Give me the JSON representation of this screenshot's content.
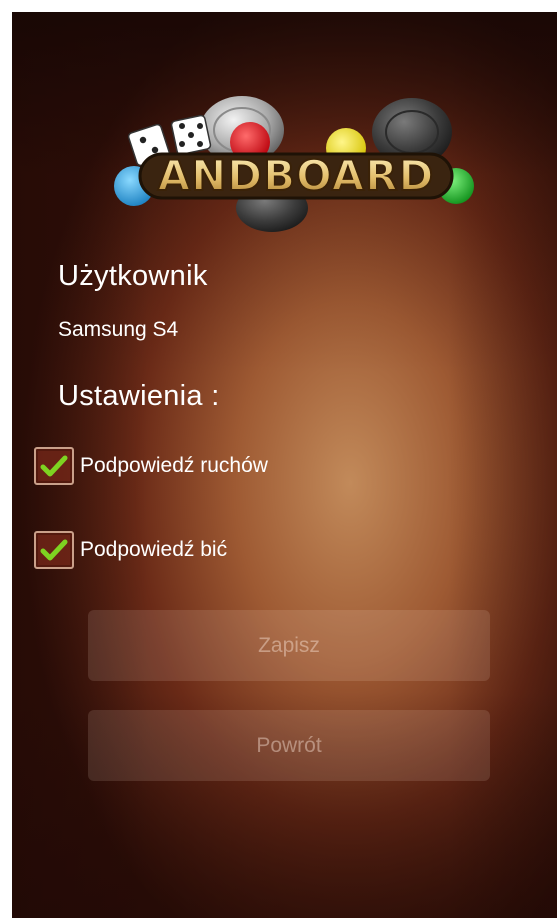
{
  "app": {
    "logo_text": "ANDBOARD"
  },
  "user": {
    "title": "Użytkownik",
    "device_name": "Samsung S4"
  },
  "settings": {
    "title": "Ustawienia :",
    "options": [
      {
        "label": "Podpowiedź ruchów",
        "checked": true
      },
      {
        "label": "Podpowiedź bić",
        "checked": true
      }
    ]
  },
  "buttons": {
    "save_label": "Zapisz",
    "back_label": "Powrót"
  },
  "icons": {
    "checkmark": "check-icon"
  },
  "colors": {
    "check_green": "#7ed321",
    "text": "#ffffff",
    "button_text": "#d9bfb0"
  }
}
